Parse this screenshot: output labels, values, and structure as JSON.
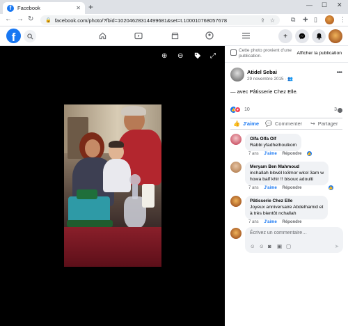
{
  "browser": {
    "tab_title": "Facebook",
    "url": "facebook.com/photo/?fbid=10204628314499681&set=t.100010768057678",
    "new_tab": "+",
    "minimize": "—",
    "maximize": "☐",
    "close": "✕"
  },
  "panel": {
    "public_notice": "Cette photo provient d'une publication.",
    "view_post": "Afficher la publication",
    "post": {
      "author": "Atidel Sebai",
      "date": "29 novembre 2015 · ",
      "text": "— avec Pâtisserie Chez Elle.",
      "reactions_count": "10",
      "comments_count": "3"
    },
    "actions": {
      "like": "J'aime",
      "comment": "Commenter",
      "share": "Partager"
    },
    "comments": [
      {
        "name": "Olfa Olfa Olf",
        "text": [
          "Rabbi yfadhelhoulkom"
        ],
        "age": "7 ans",
        "like": "J'aime",
        "reply": "Répondre"
      },
      {
        "name": "Meryam Ben Mahmoud",
        "text": [
          "inchallah bitwël lo3mor wkol 3am w",
          "howa balf khir !! bisoux adoulti"
        ],
        "age": "7 ans",
        "like": "J'aime",
        "reply": "Répondre"
      },
      {
        "name": "Pâtisserie Chez Elle",
        "text": [
          "Joyeux anniversaire Abdelhamid et",
          "à très bientôt nchallah"
        ],
        "age": "7 ans",
        "like": "J'aime",
        "reply": "Répondre"
      }
    ],
    "write_placeholder": "Écrivez un commentaire…"
  },
  "colors": {
    "fb_blue": "#1877f2",
    "love_red": "#f33e58",
    "viewer_bg": "#000000"
  },
  "icons": {
    "zoom_in": "⊕",
    "zoom_out": "⊖",
    "tag": "🏷",
    "fullscreen": "⤢"
  }
}
